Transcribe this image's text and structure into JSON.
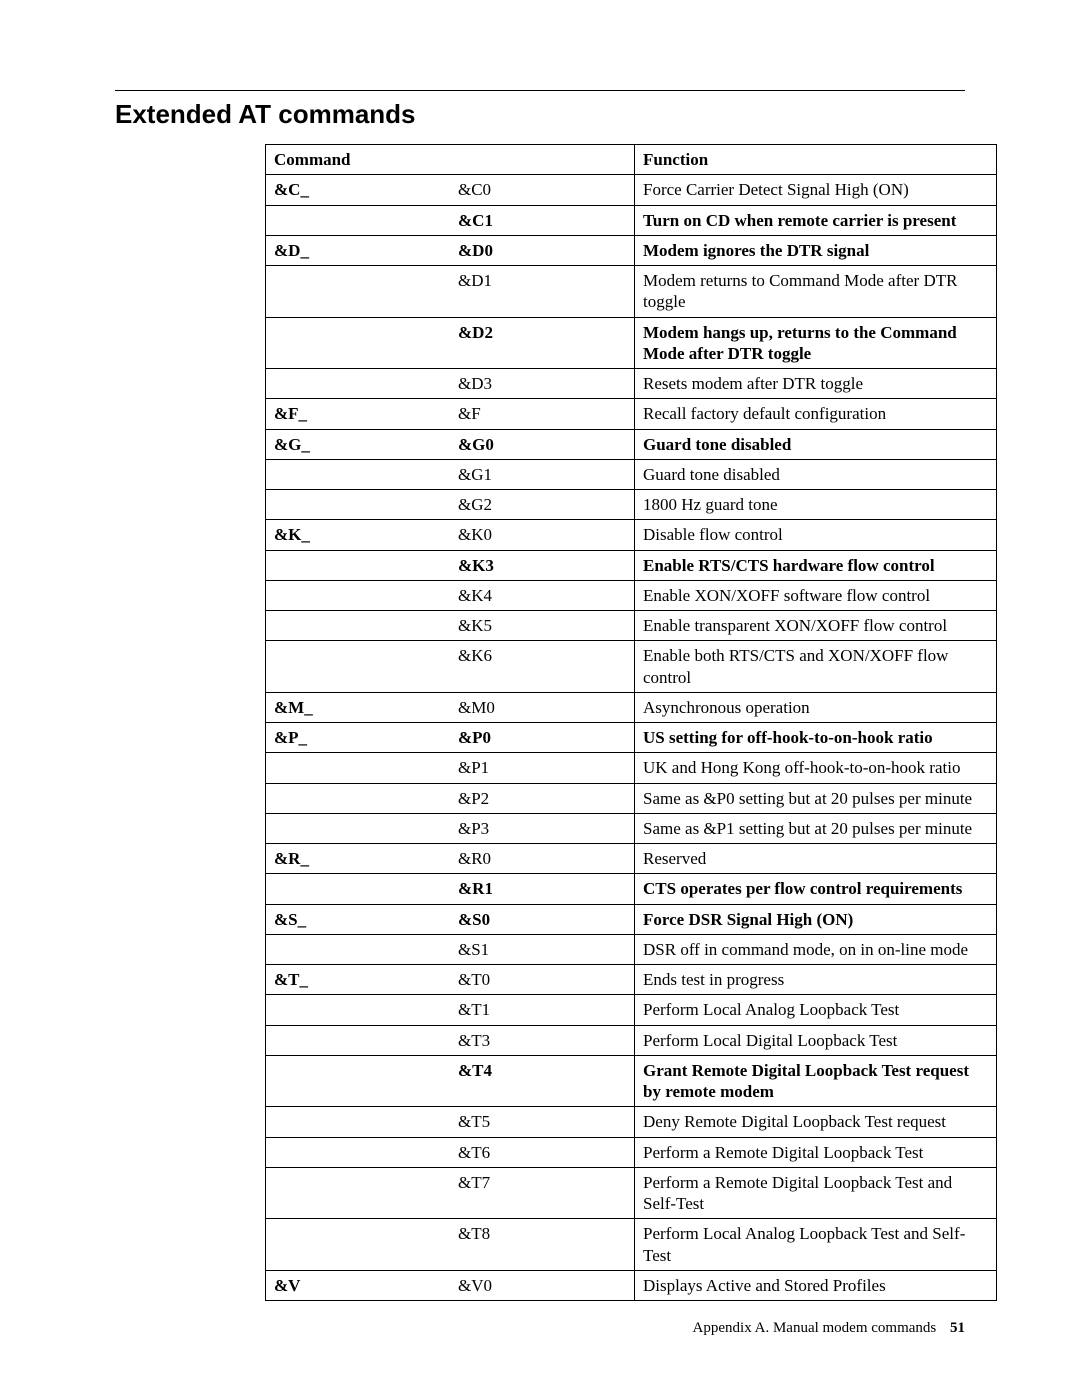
{
  "title": "Extended AT commands",
  "headers": {
    "command": "Command",
    "function": "Function"
  },
  "rows": [
    {
      "group": "&C_",
      "code": "&C0",
      "func": "Force Carrier Detect Signal High (ON)",
      "bold": false
    },
    {
      "group": "",
      "code": "&C1",
      "func": "Turn on CD when remote carrier is present",
      "bold": true
    },
    {
      "group": "&D_",
      "code": "&D0",
      "func": "Modem ignores the DTR signal",
      "bold": true
    },
    {
      "group": "",
      "code": "&D1",
      "func": "Modem returns to Command Mode after DTR toggle",
      "bold": false
    },
    {
      "group": "",
      "code": "&D2",
      "func": "Modem hangs up, returns to the Command Mode after DTR toggle",
      "bold": true
    },
    {
      "group": "",
      "code": "&D3",
      "func": "Resets modem after DTR toggle",
      "bold": false
    },
    {
      "group": "&F_",
      "code": "&F",
      "func": "Recall factory default configuration",
      "bold": false
    },
    {
      "group": "&G_",
      "code": "&G0",
      "func": "Guard tone disabled",
      "bold": true
    },
    {
      "group": "",
      "code": "&G1",
      "func": "Guard tone disabled",
      "bold": false
    },
    {
      "group": "",
      "code": "&G2",
      "func": "1800 Hz guard tone",
      "bold": false
    },
    {
      "group": "&K_",
      "code": "&K0",
      "func": "Disable flow control",
      "bold": false
    },
    {
      "group": "",
      "code": "&K3",
      "func": "Enable RTS/CTS hardware flow control",
      "bold": true
    },
    {
      "group": "",
      "code": "&K4",
      "func": "Enable XON/XOFF software flow control",
      "bold": false
    },
    {
      "group": "",
      "code": "&K5",
      "func": "Enable transparent XON/XOFF flow control",
      "bold": false
    },
    {
      "group": "",
      "code": "&K6",
      "func": "Enable both RTS/CTS and XON/XOFF flow control",
      "bold": false
    },
    {
      "group": "&M_",
      "code": "&M0",
      "func": "Asynchronous operation",
      "bold": false
    },
    {
      "group": "&P_",
      "code": "&P0",
      "func": "US setting for off-hook-to-on-hook ratio",
      "bold": true
    },
    {
      "group": "",
      "code": "&P1",
      "func": "UK and Hong Kong off-hook-to-on-hook ratio",
      "bold": false
    },
    {
      "group": "",
      "code": "&P2",
      "func": "Same as &P0 setting but at 20 pulses per minute",
      "bold": false
    },
    {
      "group": "",
      "code": "&P3",
      "func": "Same as &P1 setting but at 20 pulses per minute",
      "bold": false
    },
    {
      "group": "&R_",
      "code": "&R0",
      "func": "Reserved",
      "bold": false
    },
    {
      "group": "",
      "code": "&R1",
      "func": "CTS operates per flow control requirements",
      "bold": true
    },
    {
      "group": "&S_",
      "code": "&S0",
      "func": "Force DSR Signal High (ON)",
      "bold": true
    },
    {
      "group": "",
      "code": "&S1",
      "func": "DSR off in command mode, on in on-line mode",
      "bold": false
    },
    {
      "group": "&T_",
      "code": "&T0",
      "func": "Ends test in progress",
      "bold": false
    },
    {
      "group": "",
      "code": "&T1",
      "func": "Perform Local Analog Loopback Test",
      "bold": false
    },
    {
      "group": "",
      "code": "&T3",
      "func": "Perform Local Digital Loopback Test",
      "bold": false
    },
    {
      "group": "",
      "code": "&T4",
      "func": "Grant Remote Digital Loopback Test request by remote modem",
      "bold": true
    },
    {
      "group": "",
      "code": "&T5",
      "func": "Deny Remote Digital Loopback Test request",
      "bold": false
    },
    {
      "group": "",
      "code": "&T6",
      "func": "Perform a Remote Digital Loopback Test",
      "bold": false
    },
    {
      "group": "",
      "code": "&T7",
      "func": "Perform a Remote Digital Loopback Test and Self-Test",
      "bold": false
    },
    {
      "group": "",
      "code": "&T8",
      "func": "Perform Local Analog Loopback Test and Self-Test",
      "bold": false
    },
    {
      "group": "&V",
      "code": "&V0",
      "func": "Displays Active and Stored Profiles",
      "bold": false
    }
  ],
  "footer": {
    "label": "Appendix A. Manual modem commands",
    "page": "51"
  }
}
